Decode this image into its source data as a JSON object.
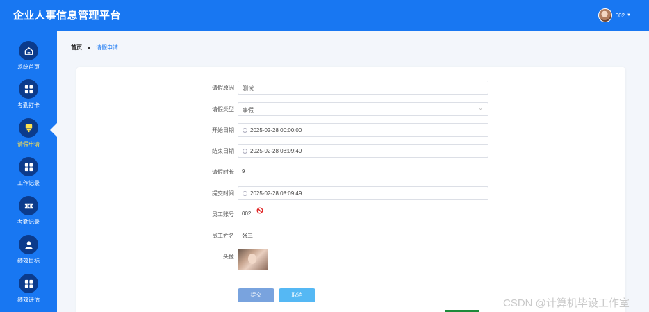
{
  "header": {
    "app_title": "企业人事信息管理平台",
    "username": "002"
  },
  "sidebar": {
    "items": [
      {
        "label": "系统首页",
        "icon": "home-icon"
      },
      {
        "label": "考勤打卡",
        "icon": "grid-icon"
      },
      {
        "label": "请假申请",
        "icon": "flag-icon",
        "active": true
      },
      {
        "label": "工作记录",
        "icon": "grid-icon"
      },
      {
        "label": "考勤记录",
        "icon": "ticket-icon"
      },
      {
        "label": "绩效目标",
        "icon": "user-icon"
      },
      {
        "label": "绩效评估",
        "icon": "grid-icon"
      }
    ]
  },
  "breadcrumb": {
    "home": "首页",
    "current": "请假申请"
  },
  "form": {
    "reason": {
      "label": "请假原因",
      "value": "测试"
    },
    "type": {
      "label": "请假类型",
      "value": "事假"
    },
    "start_date": {
      "label": "开始日期",
      "value": "2025-02-28 00:00:00"
    },
    "end_date": {
      "label": "结束日期",
      "value": "2025-02-28 08:09:49"
    },
    "duration": {
      "label": "请假时长",
      "value": "9"
    },
    "submit_time": {
      "label": "提交时间",
      "value": "2025-02-28 08:09:49"
    },
    "employee_id": {
      "label": "员工账号",
      "value": "002"
    },
    "employee_name": {
      "label": "员工姓名",
      "value": "张三"
    },
    "avatar": {
      "label": "头像"
    }
  },
  "buttons": {
    "submit": "提交",
    "cancel": "取消"
  },
  "watermark": "CSDN @计算机毕设工作室",
  "colors": {
    "primary": "#1877f2",
    "nav_icon_bg": "#0b3b8c",
    "active_label": "#ffe14d"
  }
}
